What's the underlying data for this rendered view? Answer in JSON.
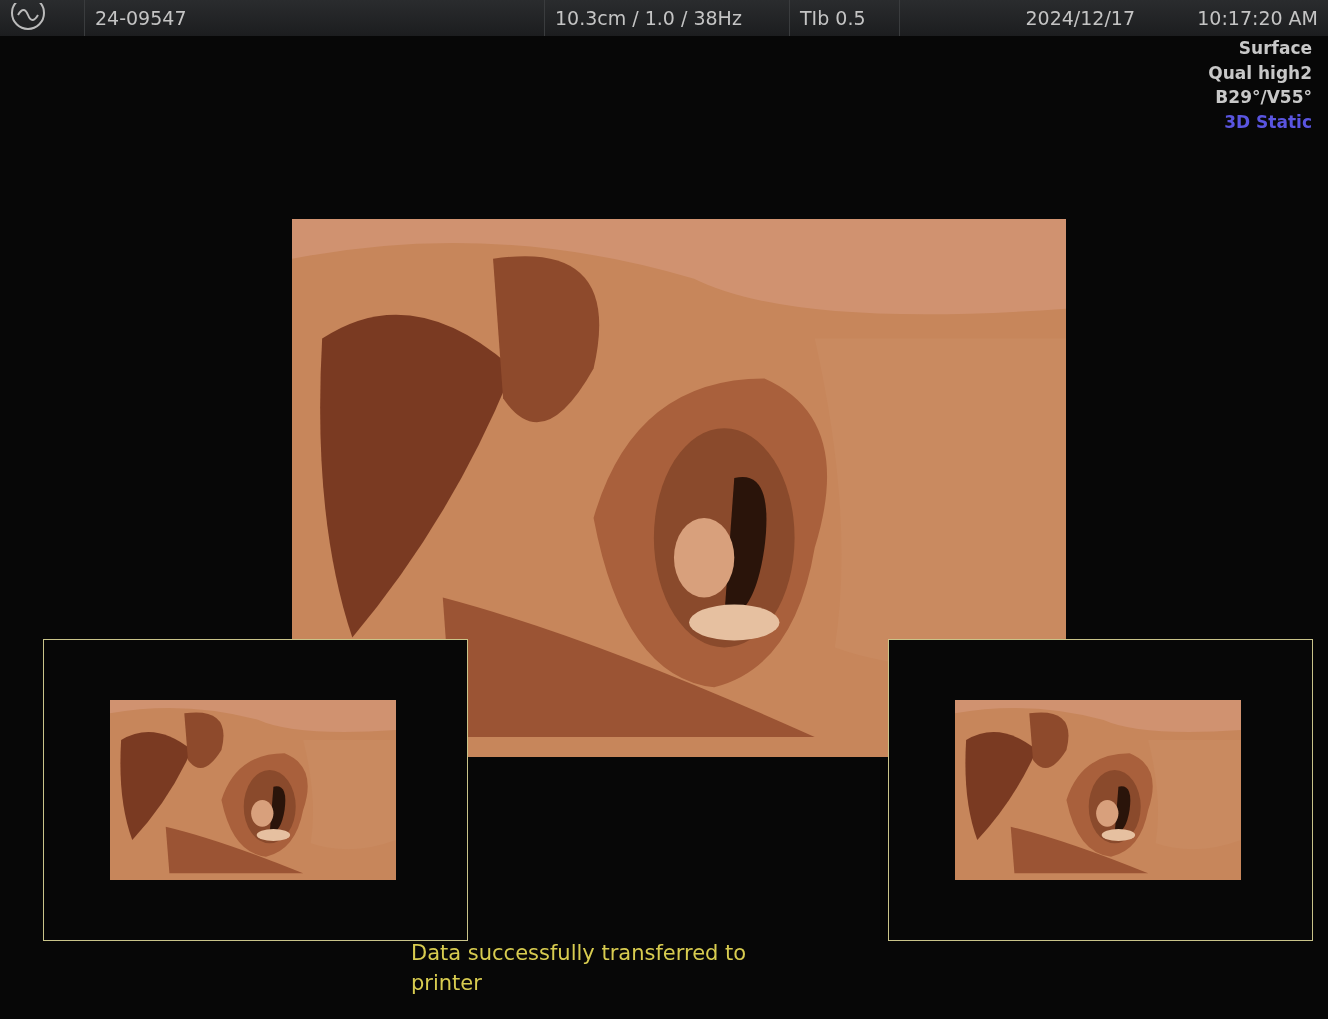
{
  "top_bar": {
    "patient_id": "24-09547",
    "depth_gain_rate": "10.3cm / 1.0 / 38Hz",
    "thermal_index": "TIb  0.5",
    "date": "2024/12/17",
    "time": "10:17:20 AM"
  },
  "render_info": [
    {
      "text": "Surface",
      "color": "#c8c8c8"
    },
    {
      "text": "Qual high2",
      "color": "#c8c8c8"
    },
    {
      "text": "B29°/V55°",
      "color": "#c8c8c8"
    },
    {
      "text": "3D Static",
      "color": "#5a55e0"
    }
  ],
  "message": "Data successfully transferred to printer"
}
